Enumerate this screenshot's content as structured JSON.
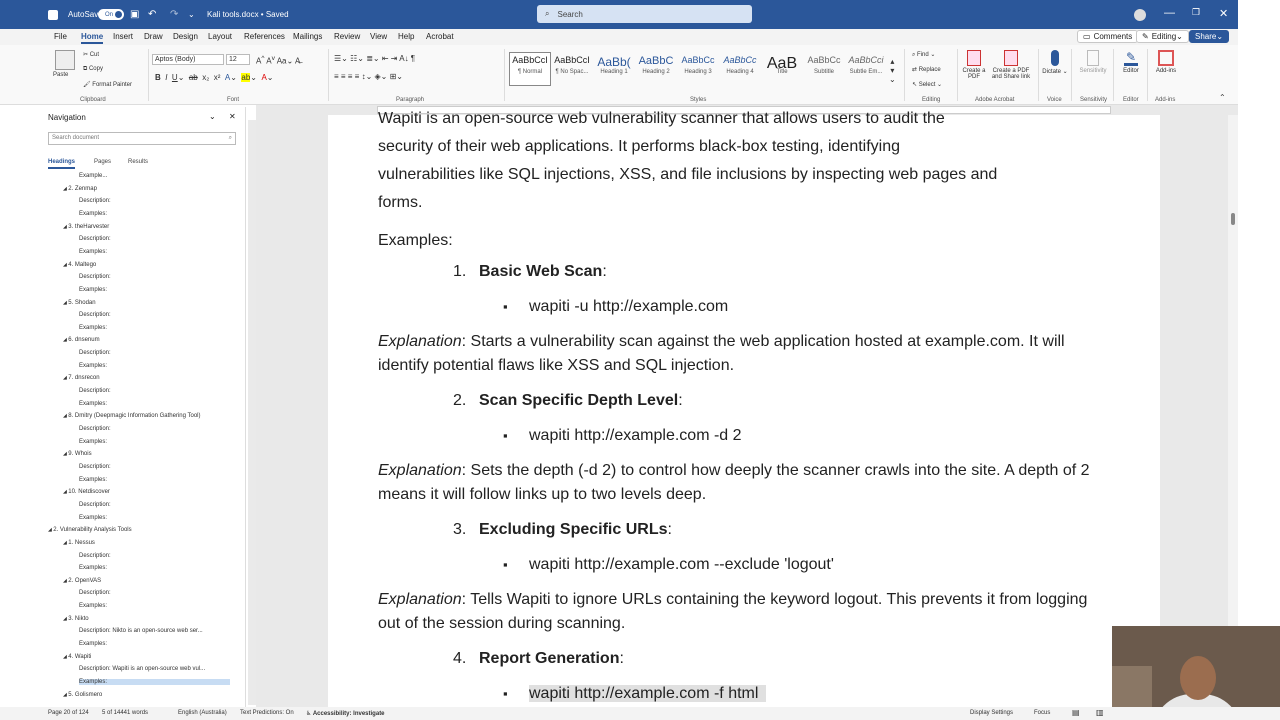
{
  "titlebar": {
    "autosave_label": "AutoSave",
    "autosave_state": "On",
    "doc_title": "Kali tools.docx • Saved",
    "search_placeholder": "Search"
  },
  "menu": [
    "File",
    "Home",
    "Insert",
    "Draw",
    "Design",
    "Layout",
    "References",
    "Mailings",
    "Review",
    "View",
    "Help",
    "Acrobat"
  ],
  "menu_buttons": {
    "comments": "Comments",
    "editing": "Editing",
    "share": "Share"
  },
  "ribbon": {
    "clipboard": {
      "paste": "Paste",
      "cut": "Cut",
      "copy": "Copy",
      "format_painter": "Format Painter",
      "label": "Clipboard"
    },
    "font": {
      "name": "Aptos (Body)",
      "size": "12",
      "label": "Font"
    },
    "paragraph_label": "Paragraph",
    "styles": [
      {
        "sample": "AaBbCcI",
        "name": "¶ Normal"
      },
      {
        "sample": "AaBbCcI",
        "name": "¶ No Spac..."
      },
      {
        "sample": "AaBb(",
        "name": "Heading 1"
      },
      {
        "sample": "AaBbC",
        "name": "Heading 2"
      },
      {
        "sample": "AaBbCc",
        "name": "Heading 3"
      },
      {
        "sample": "AaBbCc",
        "name": "Heading 4"
      },
      {
        "sample": "AaB",
        "name": "Title"
      },
      {
        "sample": "AaBbCc",
        "name": "Subtitle"
      },
      {
        "sample": "AaBbCci",
        "name": "Subtle Em..."
      }
    ],
    "styles_label": "Styles",
    "editing": {
      "find": "Find",
      "replace": "Replace",
      "select": "Select",
      "label": "Editing"
    },
    "acrobat": {
      "create_pdf": "Create a PDF",
      "create_share": "Create a PDF and Share link",
      "label": "Adobe Acrobat"
    },
    "voice": {
      "dictate": "Dictate",
      "label": "Voice"
    },
    "sensitivity": {
      "btn": "Sensitivity",
      "label": "Sensitivity"
    },
    "editor": {
      "btn": "Editor",
      "label": "Editor"
    },
    "addins": {
      "btn": "Add-ins",
      "label": "Add-ins"
    }
  },
  "nav": {
    "title": "Navigation",
    "search_placeholder": "Search document",
    "tabs": [
      "Headings",
      "Pages",
      "Results"
    ],
    "items": [
      {
        "text": "Example...",
        "level": 3
      },
      {
        "text": "2. Zenmap",
        "level": 2
      },
      {
        "text": "Description:",
        "level": 3
      },
      {
        "text": "Examples:",
        "level": 3
      },
      {
        "text": "3. theHarvester",
        "level": 2
      },
      {
        "text": "Description:",
        "level": 3
      },
      {
        "text": "Examples:",
        "level": 3
      },
      {
        "text": "4. Maltego",
        "level": 2
      },
      {
        "text": "Description:",
        "level": 3
      },
      {
        "text": "Examples:",
        "level": 3
      },
      {
        "text": "5. Shodan",
        "level": 2
      },
      {
        "text": "Description:",
        "level": 3
      },
      {
        "text": "Examples:",
        "level": 3
      },
      {
        "text": "6. dnsenum",
        "level": 2
      },
      {
        "text": "Description:",
        "level": 3
      },
      {
        "text": "Examples:",
        "level": 3
      },
      {
        "text": "7. dnsrecon",
        "level": 2
      },
      {
        "text": "Description:",
        "level": 3
      },
      {
        "text": "Examples:",
        "level": 3
      },
      {
        "text": "8. Dmitry (Deepmagic Information Gathering Tool)",
        "level": 2
      },
      {
        "text": "Description:",
        "level": 3
      },
      {
        "text": "Examples:",
        "level": 3
      },
      {
        "text": "9. Whois",
        "level": 2
      },
      {
        "text": "Description:",
        "level": 3
      },
      {
        "text": "Examples:",
        "level": 3
      },
      {
        "text": "10. Netdiscover",
        "level": 2
      },
      {
        "text": "Description:",
        "level": 3
      },
      {
        "text": "Examples:",
        "level": 3
      },
      {
        "text": "2. Vulnerability Analysis Tools",
        "level": 1
      },
      {
        "text": "1. Nessus",
        "level": 2
      },
      {
        "text": "Description:",
        "level": 3
      },
      {
        "text": "Examples:",
        "level": 3
      },
      {
        "text": "2. OpenVAS",
        "level": 2
      },
      {
        "text": "Description:",
        "level": 3
      },
      {
        "text": "Examples:",
        "level": 3
      },
      {
        "text": "3. Nikto",
        "level": 2
      },
      {
        "text": "Description:  Nikto is an open-source web ser...",
        "level": 3
      },
      {
        "text": "Examples:",
        "level": 3
      },
      {
        "text": "4. Wapiti",
        "level": 2
      },
      {
        "text": "Description:  Wapiti is an open-source web vul...",
        "level": 3
      },
      {
        "text": "Examples:",
        "level": 3,
        "selected": true
      },
      {
        "text": "5. Golismero",
        "level": 2
      }
    ]
  },
  "doc": {
    "intro_lines": [
      "Wapiti is an open-source web vulnerability scanner that allows users to audit the",
      "security of their web applications. It performs black-box testing, identifying",
      "vulnerabilities like SQL injections, XSS, and file inclusions by inspecting web pages and",
      "forms."
    ],
    "examples_heading": "Examples:",
    "items": [
      {
        "num": "1.",
        "title": "Basic Web Scan",
        "cmd": "wapiti -u http://example.com",
        "exp_label": "Explanation",
        "exp_lines": [
          ": Starts a vulnerability scan against the web application hosted at example.com. It will",
          "identify potential flaws like XSS and SQL injection."
        ]
      },
      {
        "num": "2.",
        "title": "Scan Specific Depth Level",
        "cmd": "wapiti http://example.com -d 2",
        "exp_label": "Explanation",
        "exp_lines": [
          ": Sets the depth (-d 2) to control how deeply the scanner crawls into the site. A depth of 2",
          "means it will follow links up to two levels deep."
        ]
      },
      {
        "num": "3.",
        "title": "Excluding Specific URLs",
        "cmd": "wapiti http://example.com --exclude 'logout'",
        "exp_label": "Explanation",
        "exp_lines": [
          ": Tells Wapiti to ignore URLs containing the keyword logout. This prevents it from logging",
          "out of the session during scanning."
        ]
      },
      {
        "num": "4.",
        "title": "Report Generation",
        "cmd": "wapiti http://example.com -f html"
      }
    ]
  },
  "status": {
    "page": "Page 20 of 124",
    "words": "5 of 14441 words",
    "lang": "English (Australia)",
    "predictions": "Text Predictions: On",
    "accessibility": "Accessibility: Investigate",
    "display": "Display Settings",
    "focus": "Focus"
  }
}
